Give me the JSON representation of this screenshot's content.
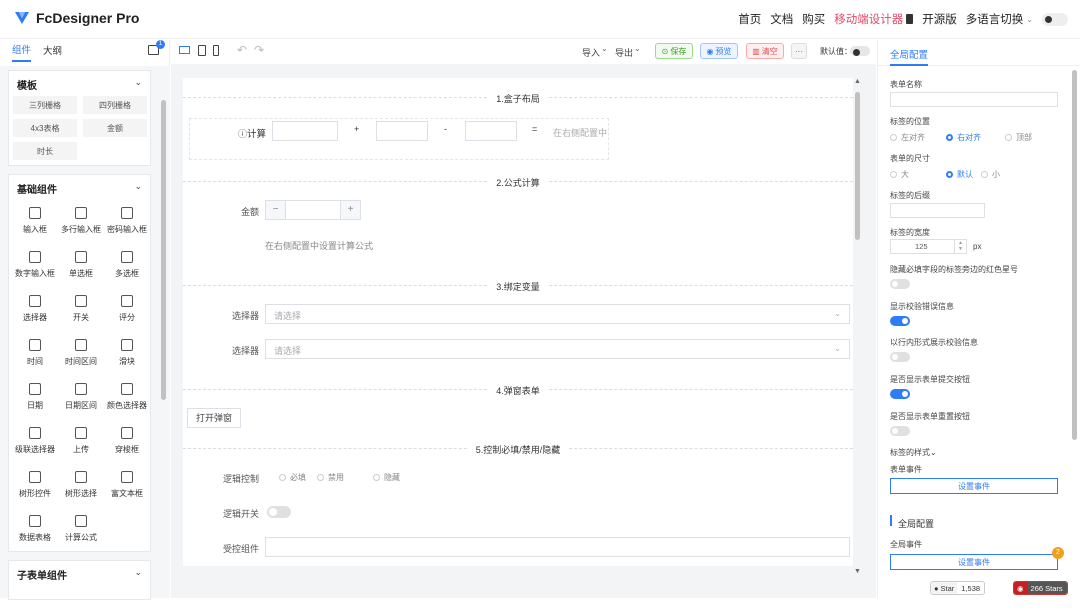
{
  "brand": {
    "title": "FcDesigner Pro",
    "accent": "#2f7df6"
  },
  "nav": {
    "home": "首页",
    "docs": "文档",
    "buy": "购买",
    "mobile": "移动端设计器",
    "opensource": "开源版",
    "lang": "多语言切换"
  },
  "left": {
    "tabs": [
      "组件",
      "大纲"
    ],
    "badge": "1",
    "template": {
      "title": "模板",
      "items": [
        "三列栅格",
        "四列栅格",
        "4x3表格",
        "金额",
        "时长"
      ]
    },
    "basic": {
      "title": "基础组件",
      "items": [
        "输入框",
        "多行输入框",
        "密码输入框",
        "数字输入框",
        "单选框",
        "多选框",
        "选择器",
        "开关",
        "评分",
        "时间",
        "时间区间",
        "滑块",
        "日期",
        "日期区间",
        "颜色选择器",
        "级联选择器",
        "上传",
        "穿梭框",
        "树形控件",
        "树形选择",
        "富文本框",
        "数据表格",
        "计算公式"
      ]
    },
    "sub": {
      "title": "子表单组件"
    }
  },
  "toolbar": {
    "import": "导入",
    "export": "导出",
    "save": "保存",
    "preview": "预览",
    "clear": "清空",
    "more": "···",
    "default_label": "默认值："
  },
  "canvas": {
    "s1": "1.盒子布局",
    "calc_label": "计算",
    "ops": [
      "+",
      "-",
      "="
    ],
    "calc_hint": "在右侧配置中",
    "s2": "2.公式计算",
    "amount_label": "金额",
    "minus": "−",
    "plus": "+",
    "formula_hint": "在右侧配置中设置计算公式",
    "s3": "3.绑定变量",
    "select_label": "选择器",
    "select_ph": "请选择",
    "s4": "4.弹窗表单",
    "open_dialog": "打开弹窗",
    "s5": "5.控制必填/禁用/隐藏",
    "logic_label": "逻辑控制",
    "logic_opts": [
      "必填",
      "禁用",
      "隐藏"
    ],
    "logic_switch_label": "逻辑开关",
    "controlled_label": "受控组件"
  },
  "right": {
    "tab": "全局配置",
    "form_name": "表单名称",
    "label_pos": "标签的位置",
    "label_pos_opts": [
      "左对齐",
      "右对齐",
      "顶部"
    ],
    "form_size": "表单的尺寸",
    "form_size_opts": [
      "大",
      "默认",
      "小"
    ],
    "label_suffix": "标签的后缀",
    "label_width": "标签的宽度",
    "label_width_value": "125",
    "unit": "px",
    "hide_star": "隐藏必填字段的标签旁边的红色星号",
    "show_err": "显示校验错误信息",
    "inline_err": "以行内形式展示校验信息",
    "show_submit": "是否显示表单提交按钮",
    "show_reset": "是否显示表单重置按钮",
    "label_style": "标签的样式",
    "form_event": "表单事件",
    "set_event": "设置事件",
    "global_section": "全局配置",
    "global_event": "全局事件",
    "set_event2": "设置事件",
    "badge2": "2"
  },
  "footer": {
    "star": "Star",
    "star_count": "1,538",
    "stars": "266 Stars"
  }
}
